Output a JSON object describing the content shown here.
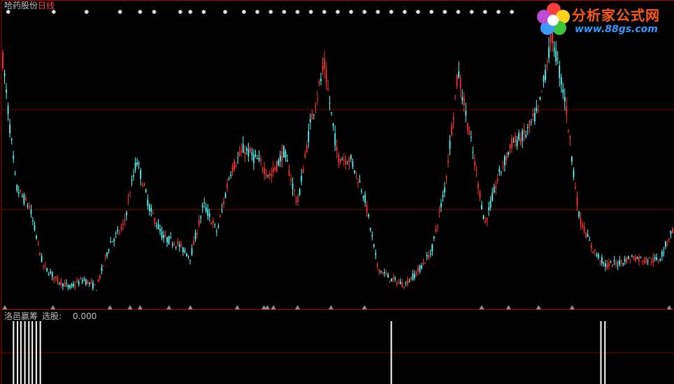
{
  "header": {
    "stock_name": "哈药股份",
    "period": "日线"
  },
  "indicator": {
    "name": "洛邑赢筹",
    "label": "选股:",
    "value": "0.000"
  },
  "logo": {
    "text": "分析家公式网",
    "url": "www.88gs.com",
    "icon": "flower-logo-icon"
  },
  "colors": {
    "up": "#ff3030",
    "down": "#54ffff",
    "frame": "#b00000",
    "grid": "#800000",
    "marker": "#ffffff",
    "triangle": "#909090",
    "signal": "#ffffff"
  },
  "chart_data": [
    {
      "type": "candlestick",
      "title": "哈药股份 日线",
      "grid": true,
      "y_relative_range": [
        0,
        1
      ],
      "note_scale": "no price axis printed; values are relative (0 = lowest, 1 = highest shown)",
      "x": [
        0,
        2,
        4,
        6,
        8,
        10,
        12,
        14,
        16,
        18,
        20,
        22,
        24,
        26,
        28,
        30,
        32,
        34,
        36,
        38,
        40,
        42,
        44,
        46,
        48,
        50,
        52,
        54,
        56,
        58,
        60,
        62,
        64,
        66,
        68,
        70,
        72,
        74,
        76,
        78,
        80,
        82,
        84,
        86,
        88,
        90,
        92,
        94,
        96,
        98,
        100
      ],
      "close": [
        0.88,
        0.42,
        0.35,
        0.14,
        0.09,
        0.06,
        0.09,
        0.06,
        0.22,
        0.28,
        0.52,
        0.34,
        0.24,
        0.22,
        0.17,
        0.36,
        0.26,
        0.48,
        0.56,
        0.52,
        0.46,
        0.55,
        0.36,
        0.66,
        0.86,
        0.53,
        0.52,
        0.39,
        0.13,
        0.09,
        0.07,
        0.12,
        0.19,
        0.42,
        0.84,
        0.57,
        0.29,
        0.46,
        0.58,
        0.61,
        0.7,
        0.97,
        0.73,
        0.32,
        0.2,
        0.14,
        0.15,
        0.17,
        0.16,
        0.16,
        0.27
      ],
      "markers_top": [
        0.8,
        7.6,
        12.5,
        17.5,
        20.5,
        22.6,
        26.5,
        28,
        30,
        33.2,
        36,
        38,
        40,
        42,
        44,
        46,
        48,
        50,
        52,
        54,
        56,
        58,
        60,
        62,
        64,
        66,
        68,
        70,
        72,
        74,
        76
      ],
      "markers_bottom": [
        0.3,
        7.5,
        16,
        19,
        20.5,
        24.8,
        28,
        35,
        39,
        39.5,
        40.4,
        44,
        49,
        54,
        71.5,
        75.5,
        80,
        85,
        99.5
      ]
    },
    {
      "type": "bar",
      "name": "洛邑赢筹",
      "series": [
        {
          "name": "选股",
          "values": [
            0.0
          ]
        }
      ],
      "signal_x": [
        1.6,
        2.2,
        2.7,
        3.3,
        3.9,
        4.4,
        5.0,
        5.6,
        58,
        89.3,
        89.9
      ]
    }
  ]
}
